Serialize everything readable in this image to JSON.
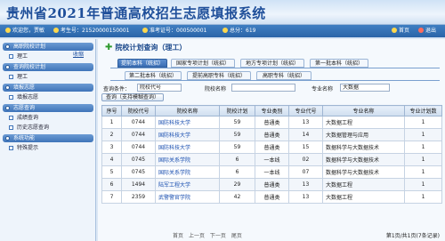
{
  "app": {
    "title": "贵州省2021年普通高校招生志愿填报系统"
  },
  "infobar": {
    "welcome": "欢迎您，贾敏",
    "exam_no_label": "考生号：",
    "exam_no": "21520000150001",
    "ticket_label": "准考证号：",
    "ticket_no": "000500001",
    "score_label": "总分：",
    "score": "619",
    "home": "首页",
    "exit": "退出"
  },
  "sidebar": {
    "collapse": "收缩",
    "groups": [
      {
        "label": "高职院校计划",
        "items": [
          "理工"
        ]
      },
      {
        "label": "查询院校计划",
        "items": [
          "理工"
        ]
      },
      {
        "label": "填报志愿",
        "items": [
          "填报志愿"
        ]
      },
      {
        "label": "志愿查询",
        "items": [
          "成绩查询",
          "历史志愿查询"
        ]
      },
      {
        "label": "系统功能",
        "items": [
          "特殊提示"
        ]
      }
    ]
  },
  "main": {
    "title": "院校计划查询（理工）",
    "tabs_row1": [
      "提前本科（统招）",
      "国家专项计划（统招）",
      "地方专项计划（统招）",
      "第一批本科（统招）"
    ],
    "tabs_row2": [
      "第二批本科（统招）",
      "提前高职专科（统招）",
      "高职专科（统招）"
    ],
    "query": {
      "condition_label": "查询条件：",
      "code_label": "院校代号",
      "name_label": "院校名称",
      "major_label": "专业名称",
      "major_value": "大数据",
      "button": "查询（支持模糊查询）"
    },
    "table": {
      "headers": [
        "序号",
        "院校代号",
        "院校名称",
        "院校计划",
        "专业类别",
        "专业代号",
        "专业名称",
        "专业计划数"
      ],
      "rows": [
        [
          "1",
          "0744",
          "国防科技大学",
          "59",
          "普通类",
          "13",
          "大数据工程",
          "1"
        ],
        [
          "2",
          "0744",
          "国防科技大学",
          "59",
          "普通类",
          "14",
          "大数据管理与应用",
          "1"
        ],
        [
          "3",
          "0744",
          "国防科技大学",
          "59",
          "普通类",
          "15",
          "数据科学与大数据技术",
          "1"
        ],
        [
          "4",
          "0745",
          "国际关系学院",
          "6",
          "一本线",
          "02",
          "数据科学与大数据技术",
          "1"
        ],
        [
          "5",
          "0745",
          "国际关系学院",
          "6",
          "一本线",
          "07",
          "数据科学与大数据技术",
          "1"
        ],
        [
          "6",
          "1494",
          "陆军工程大学",
          "29",
          "普通类",
          "13",
          "大数据工程",
          "1"
        ],
        [
          "7",
          "2359",
          "武警警官学院",
          "42",
          "普通类",
          "13",
          "大数据工程",
          "1"
        ]
      ]
    },
    "pager": {
      "first": "首页",
      "prev": "上一页",
      "next": "下一页",
      "last": "尾页",
      "info": "第1页/共1页(7条记录)"
    }
  }
}
